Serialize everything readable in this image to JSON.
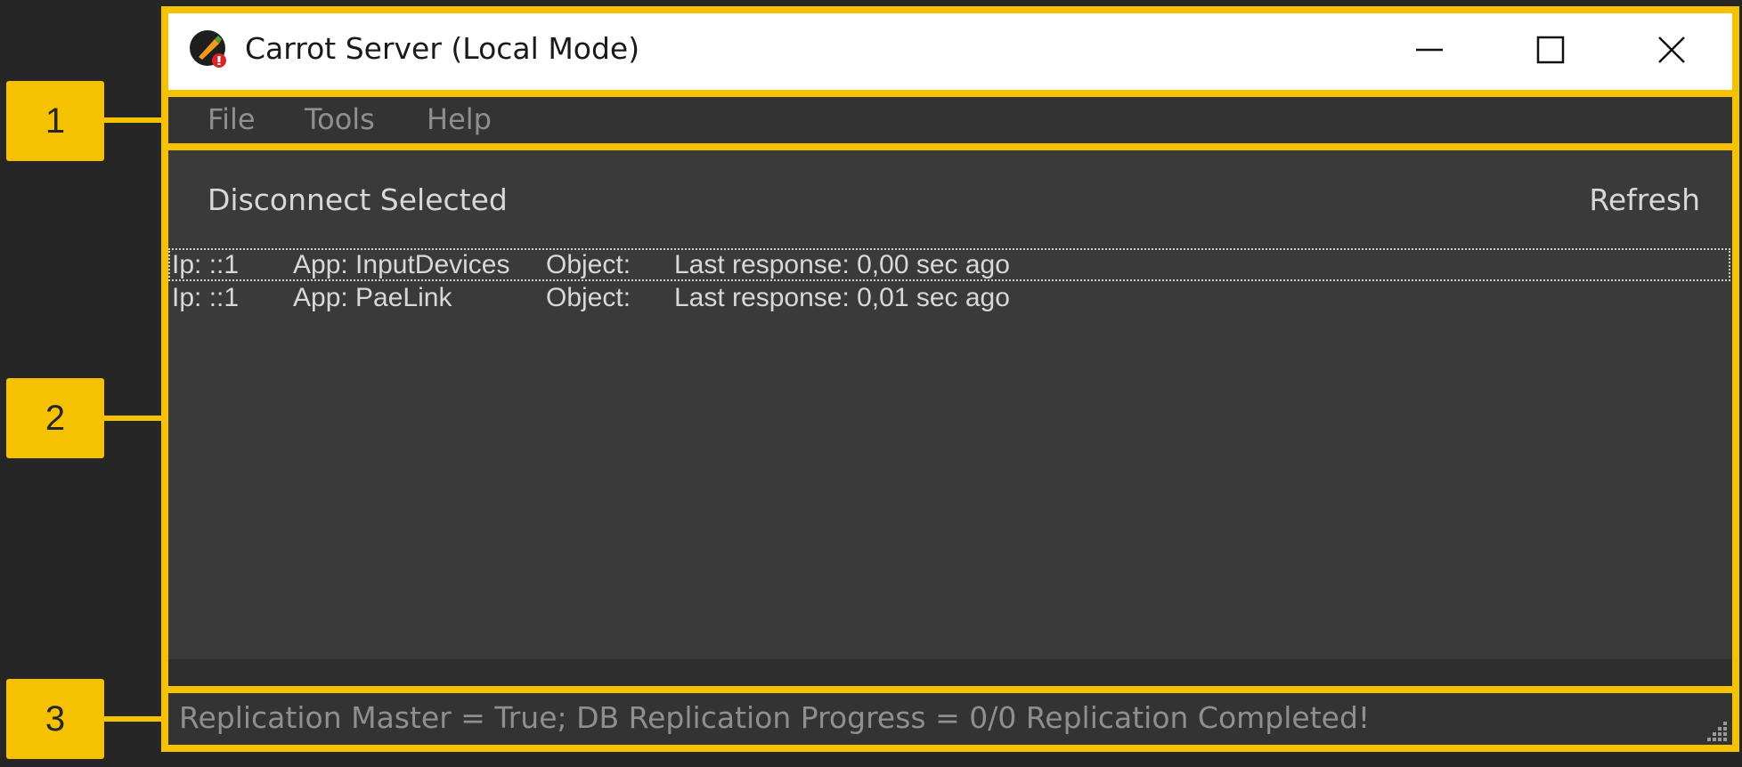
{
  "window": {
    "title": "Carrot Server (Local Mode)",
    "icon": "carrot-server-app-icon",
    "controls": [
      "minimize-icon",
      "maximize-icon",
      "close-icon"
    ]
  },
  "menu": {
    "items": [
      {
        "label": "File"
      },
      {
        "label": "Tools"
      },
      {
        "label": "Help"
      }
    ]
  },
  "toolbar": {
    "disconnect_label": "Disconnect Selected",
    "refresh_label": "Refresh"
  },
  "connections": [
    {
      "ip": "Ip: ::1",
      "app": "App: InputDevices",
      "object": "Object:",
      "last_response": "Last response: 0,00 sec ago",
      "focused": true
    },
    {
      "ip": "Ip: ::1",
      "app": "App: PaeLink",
      "object": "Object:",
      "last_response": "Last response: 0,01 sec ago",
      "focused": false
    }
  ],
  "status": {
    "text": "Replication Master = True; DB Replication Progress = 0/0 Replication Completed!"
  },
  "callouts": [
    "1",
    "2",
    "3"
  ],
  "colors": {
    "highlight": "#f6c200",
    "background": "#262626",
    "panel": "#3a3a3a",
    "menu_text": "#8f8f8f",
    "list_text": "#d8d8d8"
  }
}
